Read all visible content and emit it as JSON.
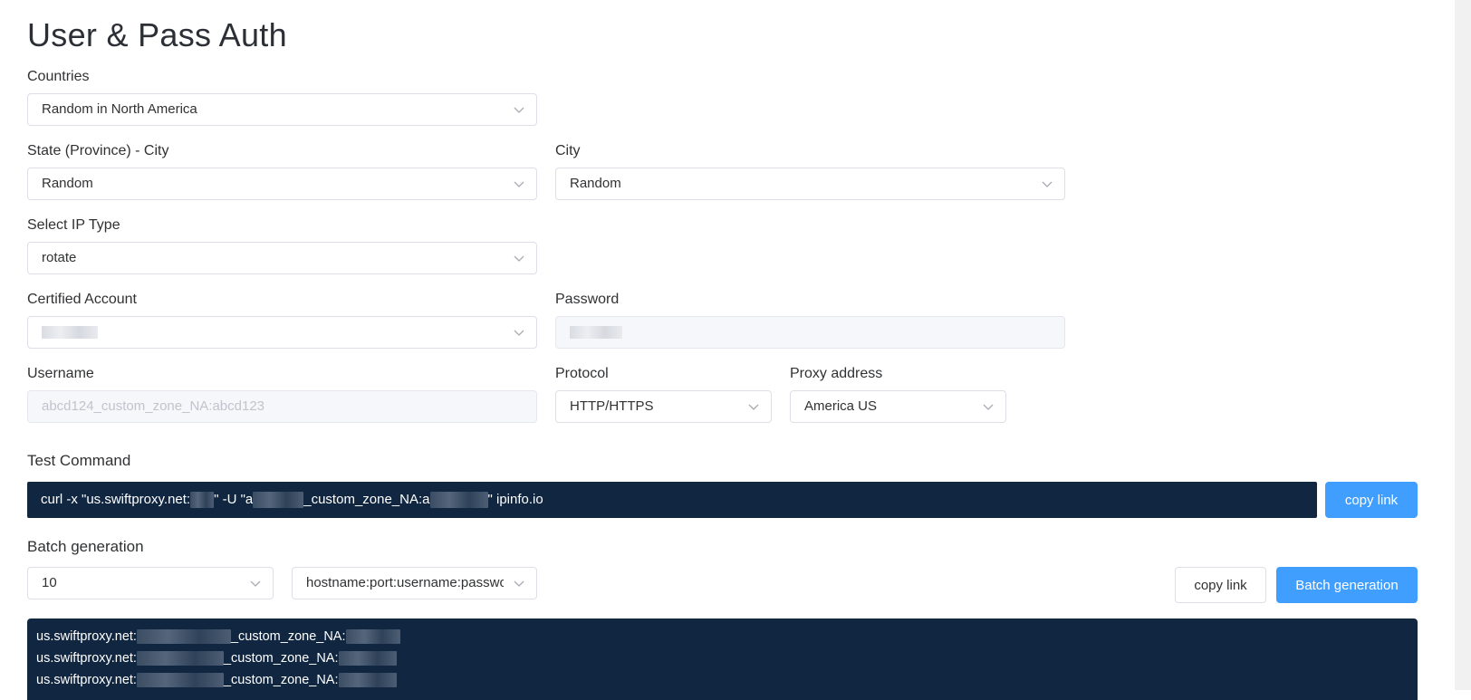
{
  "page_title": "User & Pass Auth",
  "countries": {
    "label": "Countries",
    "value": "Random in North America"
  },
  "state": {
    "label": "State (Province) - City",
    "value": "Random"
  },
  "city": {
    "label": "City",
    "value": "Random"
  },
  "ip_type": {
    "label": "Select IP Type",
    "value": "rotate"
  },
  "account": {
    "label": "Certified Account",
    "value": ""
  },
  "password": {
    "label": "Password",
    "value": ""
  },
  "username": {
    "label": "Username",
    "placeholder": "abcd124_custom_zone_NA:abcd123"
  },
  "protocol": {
    "label": "Protocol",
    "value": "HTTP/HTTPS"
  },
  "proxy_address": {
    "label": "Proxy address",
    "value": "America US"
  },
  "test_command": {
    "label": "Test Command",
    "part1": "curl -x \"us.swiftproxy.net:",
    "part2": "\" -U \"a",
    "part3": "_custom_zone_NA:a",
    "part4": "\" ipinfo.io",
    "copy_label": "copy link"
  },
  "batch": {
    "label": "Batch generation",
    "count": "10",
    "format": "hostname:port:username:password",
    "copy_label": "copy link",
    "generate_label": "Batch generation",
    "lines": [
      {
        "host": "us.swiftproxy.net:",
        "zone": "_custom_zone_NA:"
      },
      {
        "host": "us.swiftproxy.net:",
        "zone": "_custom_zone_NA:"
      },
      {
        "host": "us.swiftproxy.net:",
        "zone": "_custom_zone_NA:"
      }
    ]
  },
  "colors": {
    "primary": "#409eff",
    "dark_bg": "#112640",
    "border": "#dcdfe6"
  }
}
